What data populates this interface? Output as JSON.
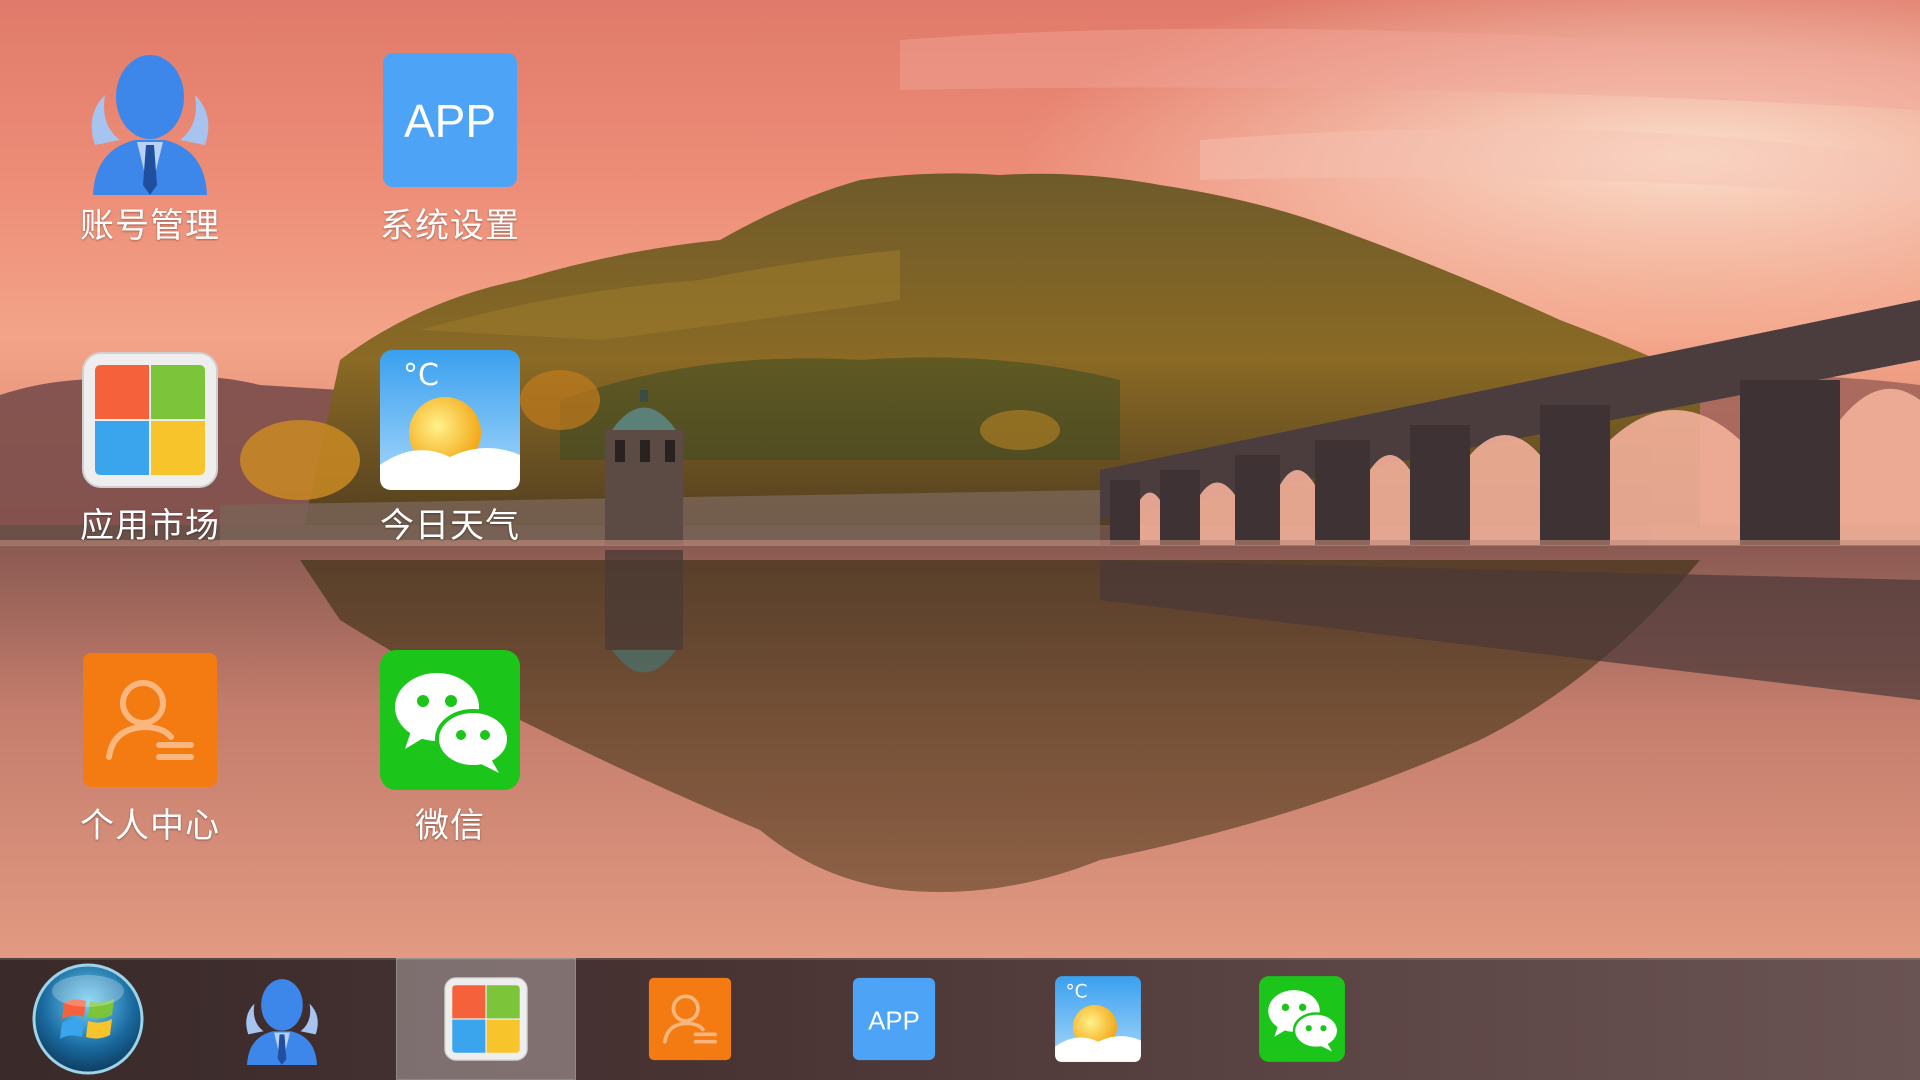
{
  "desktop": {
    "icons": [
      {
        "id": "account",
        "label": "账号管理",
        "icon": "account-person-icon"
      },
      {
        "id": "settings",
        "label": "系统设置",
        "icon": "app-settings-icon",
        "badge_text": "APP"
      },
      {
        "id": "store",
        "label": "应用市场",
        "icon": "app-store-windows-icon"
      },
      {
        "id": "weather",
        "label": "今日天气",
        "icon": "weather-sun-icon",
        "badge_text": "°C"
      },
      {
        "id": "profile",
        "label": "个人中心",
        "icon": "profile-person-icon"
      },
      {
        "id": "wechat",
        "label": "微信",
        "icon": "wechat-icon"
      }
    ]
  },
  "taskbar": {
    "start_icon": "windows-start-icon",
    "items": [
      {
        "id": "account",
        "icon": "account-person-icon",
        "active": false
      },
      {
        "id": "store",
        "icon": "app-store-windows-icon",
        "active": true
      },
      {
        "id": "profile",
        "icon": "profile-person-icon",
        "active": false
      },
      {
        "id": "settings",
        "icon": "app-settings-icon",
        "badge_text": "APP",
        "active": false
      },
      {
        "id": "weather",
        "icon": "weather-sun-icon",
        "badge_text": "°C",
        "active": false
      },
      {
        "id": "wechat",
        "icon": "wechat-icon",
        "active": false
      }
    ]
  },
  "colors": {
    "settings_blue": "#4da3f5",
    "profile_orange": "#f47a12",
    "wechat_green": "#1bc51a",
    "account_blue": "#3d86ea",
    "tile_red": "#f4613a",
    "tile_green": "#7cc43a",
    "tile_blue": "#3aa4ec",
    "tile_yellow": "#f8c42c"
  }
}
